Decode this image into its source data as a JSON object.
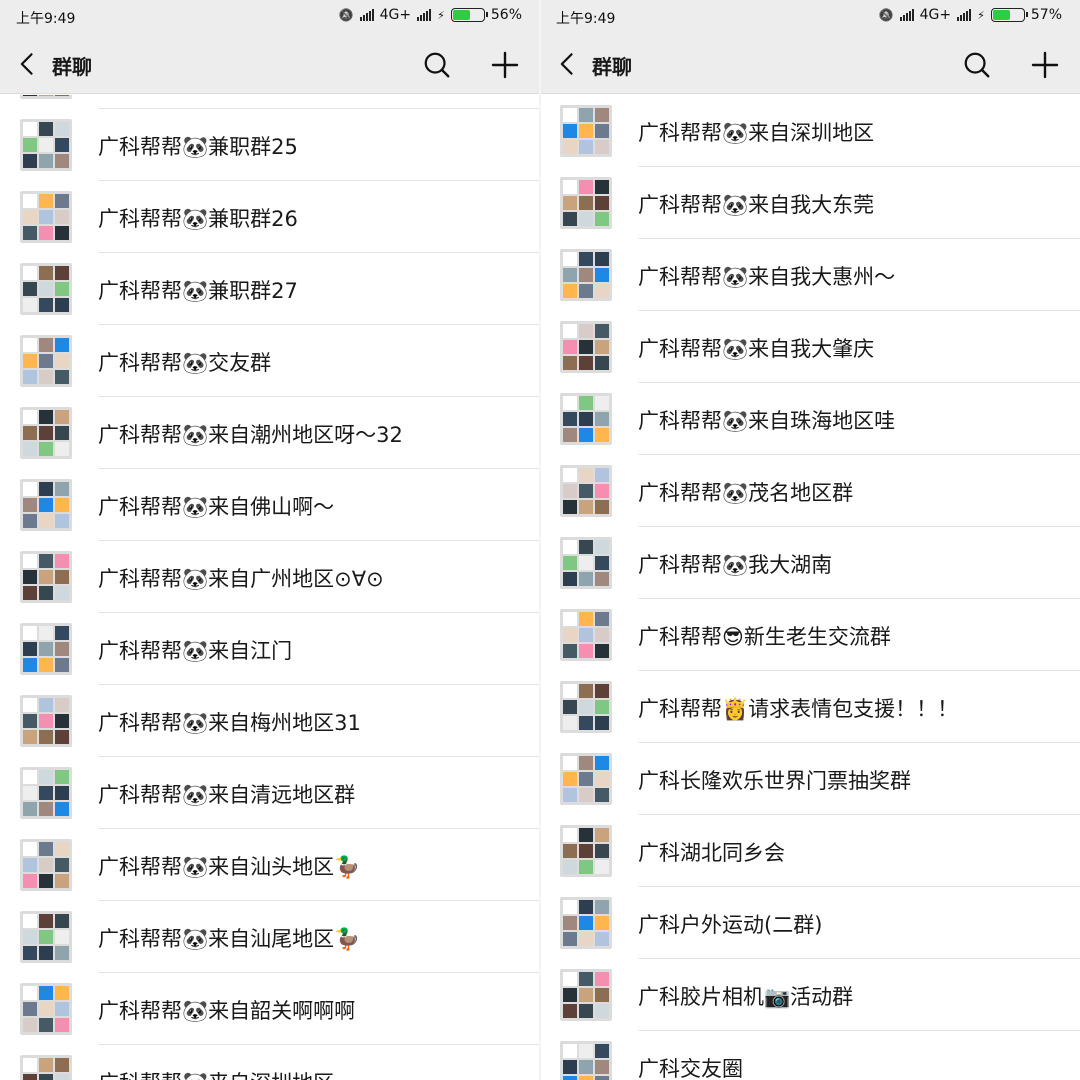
{
  "screens": [
    {
      "status": {
        "time": "上午9:49",
        "network": "4G+",
        "battery": "56%",
        "battery_level": 0.56
      },
      "nav": {
        "title": "群聊",
        "back_icon": "chevron-left-icon",
        "search_icon": "search-icon",
        "add_icon": "plus-icon"
      },
      "groups": [
        "",
        "广科帮帮🐼兼职群25",
        "广科帮帮🐼兼职群26",
        "广科帮帮🐼兼职群27",
        "广科帮帮🐼交友群",
        "广科帮帮🐼来自潮州地区呀～32",
        "广科帮帮🐼来自佛山啊～",
        "广科帮帮🐼来自广州地区⊙∀⊙",
        "广科帮帮🐼来自江门",
        "广科帮帮🐼来自梅州地区31",
        "广科帮帮🐼来自清远地区群",
        "广科帮帮🐼来自汕头地区🦆",
        "广科帮帮🐼来自汕尾地区🦆",
        "广科帮帮🐼来自韶关啊啊啊",
        "广科帮帮🐼来自深圳地区"
      ]
    },
    {
      "status": {
        "time": "上午9:49",
        "network": "4G+",
        "battery": "57%",
        "battery_level": 0.57
      },
      "nav": {
        "title": "群聊",
        "back_icon": "chevron-left-icon",
        "search_icon": "search-icon",
        "add_icon": "plus-icon"
      },
      "groups": [
        "广科帮帮🐼来自深圳地区",
        "广科帮帮🐼来自我大东莞",
        "广科帮帮🐼来自我大惠州～",
        "广科帮帮🐼来自我大肇庆",
        "广科帮帮🐼来自珠海地区哇",
        "广科帮帮🐼茂名地区群",
        "广科帮帮🐼我大湖南",
        "广科帮帮😎新生老生交流群",
        "广科帮帮👸请求表情包支援！！！",
        "广科长隆欢乐世界门票抽奖群",
        "广科湖北同乡会",
        "广科户外运动(二群)",
        "广科胶片相机📷活动群",
        "广科交友圈"
      ]
    }
  ]
}
